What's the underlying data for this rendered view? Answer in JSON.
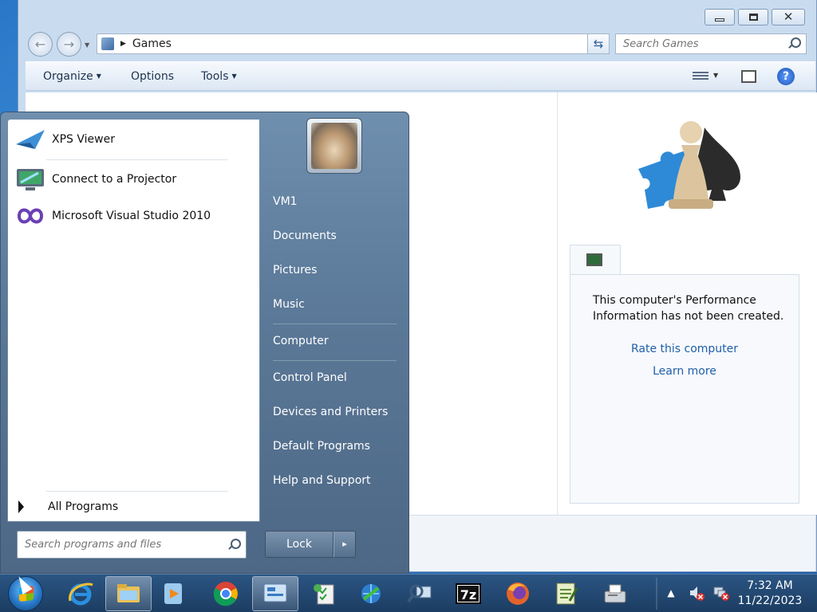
{
  "window": {
    "title_controls": {
      "minimize": "minimize",
      "maximize": "maximize",
      "close": "✕"
    },
    "nav": {
      "back": "←",
      "forward": "→"
    },
    "address": {
      "location": "Games"
    },
    "search": {
      "placeholder": "Search Games"
    },
    "commands": {
      "organize": "Organize",
      "options": "Options",
      "tools": "Tools"
    },
    "help": "?"
  },
  "details": {
    "perf_message": "This computer's Performance Information has not been created.",
    "rate_link": "Rate this computer",
    "learn_link": "Learn more"
  },
  "start_menu": {
    "programs": [
      {
        "label": "XPS Viewer",
        "icon": "xps-viewer-icon"
      },
      {
        "label": "Connect to a Projector",
        "icon": "projector-icon"
      },
      {
        "label": "Microsoft Visual Studio 2010",
        "icon": "visual-studio-icon"
      }
    ],
    "all_programs": "All Programs",
    "search_placeholder": "Search programs and files",
    "right_links": [
      "VM1",
      "Documents",
      "Pictures",
      "Music",
      "Computer",
      "Control Panel",
      "Devices and Printers",
      "Default Programs",
      "Help and Support"
    ],
    "lock": "Lock",
    "lock_arrow": "▸"
  },
  "taskbar": {
    "items": [
      {
        "name": "internet-explorer-icon",
        "active": false
      },
      {
        "name": "windows-explorer-icon",
        "active": true
      },
      {
        "name": "media-player-icon",
        "active": false
      },
      {
        "name": "chrome-icon",
        "active": false
      },
      {
        "name": "control-panel-icon",
        "active": true
      },
      {
        "name": "tasks-app-icon",
        "active": false
      },
      {
        "name": "network-globe-icon",
        "active": false
      },
      {
        "name": "search-computer-icon",
        "active": false
      },
      {
        "name": "seven-zip-icon",
        "active": false,
        "text": "7z"
      },
      {
        "name": "firefox-icon",
        "active": false
      },
      {
        "name": "notepad-app-icon",
        "active": false
      },
      {
        "name": "fax-icon",
        "active": false
      }
    ],
    "tray": {
      "expand": "▲",
      "time": "7:32 AM",
      "date": "11/22/2023"
    }
  },
  "colors": {
    "link": "#1f5fa8",
    "taskbar": "#1c3d62",
    "start_menu": "#5c7a99"
  }
}
